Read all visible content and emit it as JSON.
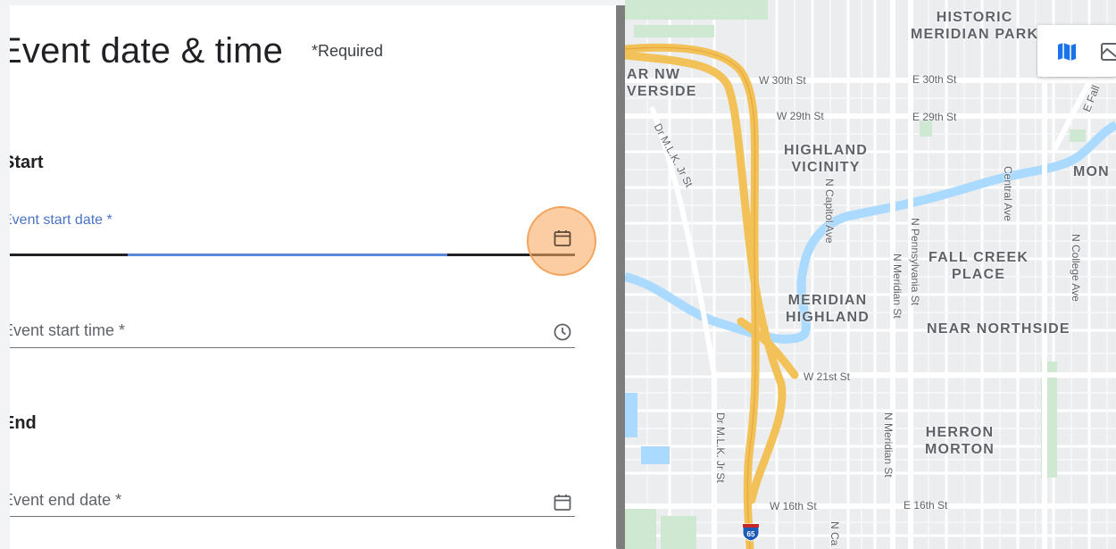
{
  "form": {
    "title": "Event date & time",
    "required_note": "*Required",
    "start_heading": "Start",
    "end_heading": "End",
    "fields": {
      "start_date_label": "Event start date *",
      "start_time_label": "Event start time *",
      "end_date_label": "Event end date *"
    }
  },
  "icons": {
    "start_date": "calendar-icon",
    "start_time": "clock-icon",
    "end_date": "calendar-icon",
    "map_view": "map-icon",
    "satellite_view": "satellite-icon"
  },
  "map": {
    "neighborhoods": {
      "historic_1": "HISTORIC",
      "historic_2": "MERIDIAN PARK",
      "near_nw_1": "AR NW",
      "near_nw_2": "VERSIDE",
      "highland_1": "HIGHLAND",
      "highland_2": "VICINITY",
      "mon": "MON",
      "fall_creek_1": "FALL CREEK",
      "fall_creek_2": "PLACE",
      "meridian_highland_1": "MERIDIAN",
      "meridian_highland_2": "HIGHLAND",
      "near_northside": "NEAR NORTHSIDE",
      "herron_1": "HERRON",
      "herron_2": "MORTON"
    },
    "streets": {
      "w30": "W 30th St",
      "e30": "E 30th St",
      "w29": "W 29th St",
      "e29": "E 29th St",
      "w21": "W 21st St",
      "w16": "W 16th St",
      "e16": "E 16th St",
      "mlk1": "Dr M.L.K. Jr St",
      "mlk2": "Dr M.L.K. Jr St",
      "capitol": "N Capitol Ave",
      "central": "Central Ave",
      "meridian1": "N Meridian St",
      "meridian2": "N Meridian St",
      "pennsylvania": "N Pennsylvania St",
      "college": "N College Ave",
      "efall": "E Fall",
      "nca": "N Ca"
    },
    "highway_shield": "65"
  }
}
